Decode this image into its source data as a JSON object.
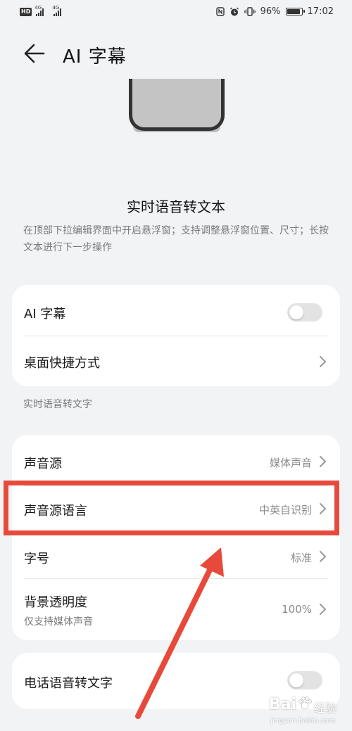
{
  "status_bar": {
    "hd": "HD",
    "signal1": "4G",
    "signal2": "4G",
    "battery_percent": "96%",
    "battery_level": 0.96,
    "time": "17:02"
  },
  "header": {
    "title": "AI 字幕"
  },
  "feature": {
    "title": "实时语音转文本",
    "description": "在顶部下拉编辑界面中开启悬浮窗；支持调整悬浮窗位置、尺寸；长按文本进行下一步操作"
  },
  "card1": {
    "ai_subtitle_label": "AI 字幕",
    "ai_subtitle_on": false,
    "desktop_shortcut_label": "桌面快捷方式"
  },
  "section_label": "实时语音转文字",
  "card2": {
    "sound_source_label": "声音源",
    "sound_source_value": "媒体声音",
    "sound_language_label": "声音源语言",
    "sound_language_value": "中英自识别",
    "font_size_label": "字号",
    "font_size_value": "标准",
    "bg_opacity_label": "背景透明度",
    "bg_opacity_sub": "仅支持媒体声音",
    "bg_opacity_value": "100%"
  },
  "card3": {
    "phone_speech_label": "电话语音转文字",
    "phone_speech_on": false
  },
  "watermark": {
    "brand": "Bai",
    "brand2": "经验",
    "url": "jingyan.baidu.com"
  },
  "colors": {
    "highlight": "#e74a3b",
    "background": "#f1f3f5"
  }
}
